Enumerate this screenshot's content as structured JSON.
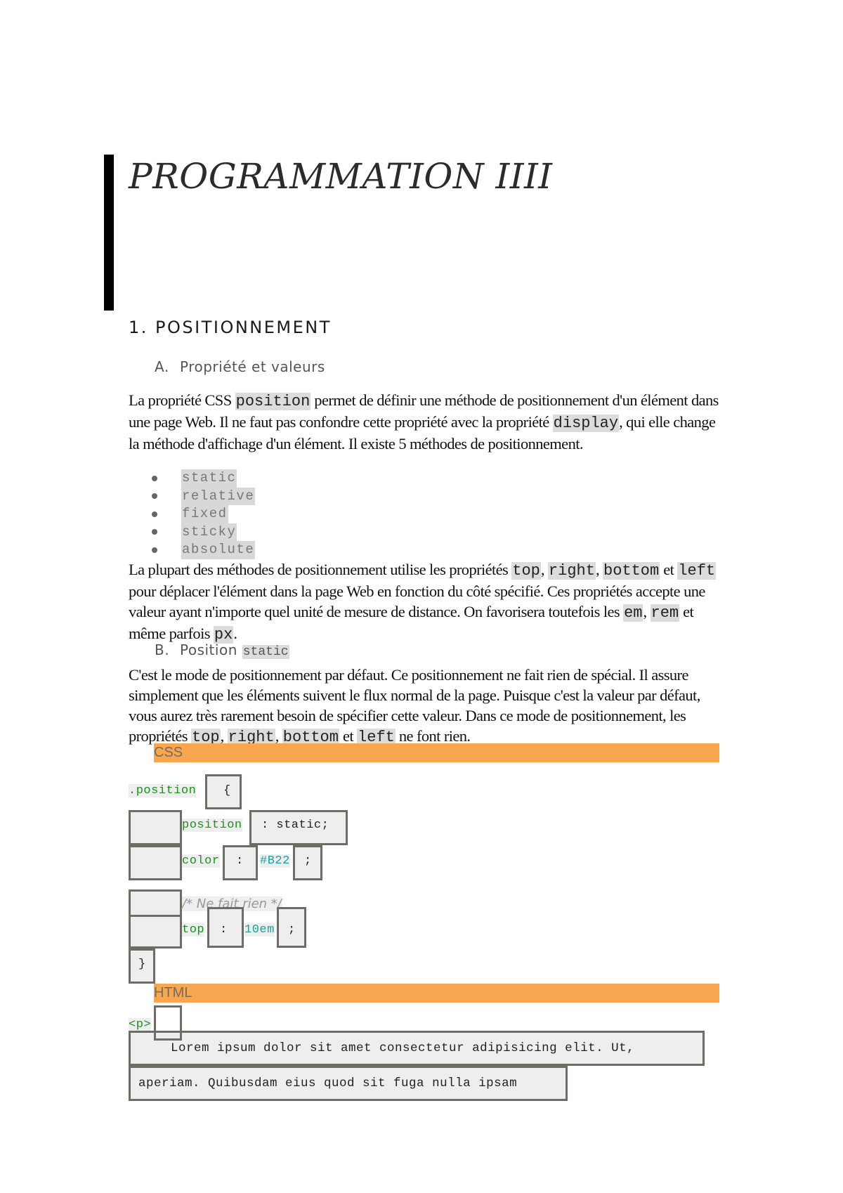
{
  "document": {
    "title": "PROGRAMMATION IIII",
    "section1": {
      "heading": "1. POSITIONNEMENT",
      "subA": {
        "letter": "A.",
        "label": "Propriété et valeurs"
      },
      "paraA": {
        "t1": "La propriété CSS ",
        "c1": "position",
        "t2": " permet de définir une méthode de positionnement d'un élément dans une page Web. Il ne faut pas confondre cette propriété avec la propriété ",
        "c2": "display",
        "t3": ", qui elle change la méthode d'affichage d'un élément. Il existe 5 méthodes de positionnement."
      },
      "methods": [
        "static",
        "relative",
        "fixed",
        "sticky",
        "absolute"
      ],
      "paraB": {
        "t1": "La plupart des méthodes de positionnement utilise les propriétés ",
        "c1": "top",
        "s1": ", ",
        "c2": "right",
        "s2": ", ",
        "c3": "bottom",
        "s3": " et ",
        "c4": "left",
        "t2": " pour déplacer l'élément dans la page Web en fonction du côté spécifié. Ces propriétés accepte une valeur ayant n'importe quel unité de mesure de distance. On favorisera toutefois les ",
        "c5": "em",
        "s4": ", ",
        "c6": "rem",
        "t3": " et même parfois ",
        "c7": "px",
        "t4": "."
      },
      "subB": {
        "letter": "B.",
        "label": "Position ",
        "code": "static"
      },
      "paraC": {
        "t1": "C'est le mode de positionnement par défaut. Ce positionnement ne fait rien de spécial. Il assure simplement que les éléments suivent le flux normal de la page. Puisque c'est la valeur par défaut, vous aurez très rarement besoin de spécifier cette valeur. Dans ce mode de positionnement, les propriétés ",
        "c1": "top",
        "s1": ", ",
        "c2": "right",
        "s2": ", ",
        "c3": "bottom",
        "s3": " et ",
        "c4": "left",
        "t2": " ne font rien."
      }
    },
    "css_block": {
      "label": "CSS",
      "selector": ".position",
      "open_brace": "{",
      "prop1": "position",
      "prop1_rest": ": static;",
      "prop2": "color",
      "colon": ":",
      "prop2_value": "#B22",
      "semicolon": ";",
      "comment": "/* Ne fait rien */",
      "prop3": "top",
      "prop3_value": "10em",
      "close_brace": "}"
    },
    "html_block": {
      "label": "HTML",
      "tag": "<p>",
      "line1": "Lorem ipsum dolor sit amet consectetur adipisicing elit. Ut,",
      "line2": "aperiam. Quibusdam eius quod sit fuga nulla ipsam"
    },
    "colors": {
      "section_bar": "#f8a64f",
      "code_keyword": "#1f8f1f",
      "code_value": "#1aa1a1",
      "inline_code_bg": "#dcdcdc"
    }
  }
}
